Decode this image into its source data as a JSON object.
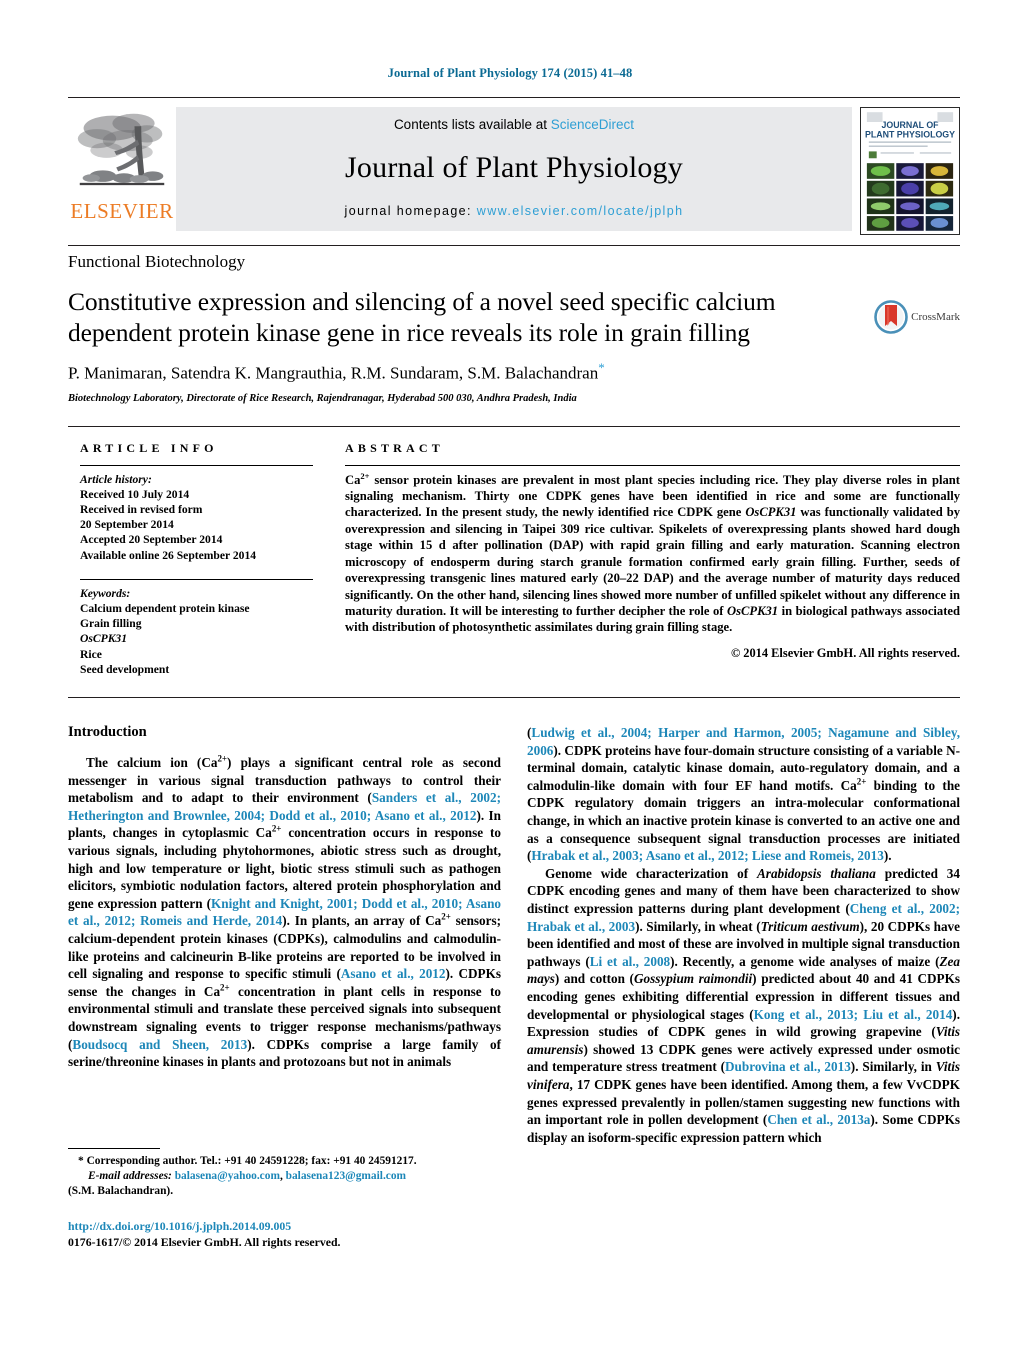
{
  "running_head": "Journal of Plant Physiology 174 (2015) 41–48",
  "masthead": {
    "contents_prefix": "Contents lists available at ",
    "sciencedirect": "ScienceDirect",
    "journal_title": "Journal of Plant Physiology",
    "homepage_prefix": "journal homepage: ",
    "homepage_url": "www.elsevier.com/locate/jplph",
    "publisher_wordmark": "ELSEVIER",
    "cover_title_line1": "JOURNAL OF",
    "cover_title_line2": "PLANT PHYSIOLOGY"
  },
  "section_label": "Functional Biotechnology",
  "title": "Constitutive expression and silencing of a novel seed specific calcium dependent protein kinase gene in rice reveals its role in grain filling",
  "authors": "P. Manimaran, Satendra K. Mangrauthia, R.M. Sundaram, S.M. Balachandran",
  "author_corresponding_marker": "*",
  "affiliation": "Biotechnology Laboratory, Directorate of Rice Research, Rajendranagar, Hyderabad 500 030, Andhra Pradesh, India",
  "crossmark_label": "CrossMark",
  "article_info": {
    "header": "ARTICLE INFO",
    "history_label": "Article history:",
    "history": [
      "Received 10 July 2014",
      "Received in revised form",
      "20 September 2014",
      "Accepted 20 September 2014",
      "Available online 26 September 2014"
    ],
    "keywords_label": "Keywords:",
    "keywords": [
      "Calcium dependent protein kinase",
      "Grain filling",
      "OsCPK31",
      "Rice",
      "Seed development"
    ],
    "keyword_italic_index": 2
  },
  "abstract": {
    "header": "ABSTRACT",
    "paragraph_parts": [
      {
        "t": "Ca",
        "s": "plain"
      },
      {
        "t": "2+",
        "s": "sup"
      },
      {
        "t": " sensor protein kinases are prevalent in most plant species including rice. They play diverse roles in plant signaling mechanism. Thirty one CDPK genes have been identified in rice and some are functionally characterized. In the present study, the newly identified rice CDPK gene ",
        "s": "plain"
      },
      {
        "t": "OsCPK31",
        "s": "italic"
      },
      {
        "t": " was functionally validated by overexpression and silencing in Taipei 309 rice cultivar. Spikelets of overexpressing plants showed hard dough stage within 15 d after pollination (DAP) with rapid grain filling and early maturation. Scanning electron microscopy of endosperm during starch granule formation confirmed early grain filling. Further, seeds of overexpressing transgenic lines matured early (20–22 DAP) and the average number of maturity days reduced significantly. On the other hand, silencing lines showed more number of unfilled spikelet without any difference in maturity duration. It will be interesting to further decipher the role of ",
        "s": "plain"
      },
      {
        "t": "OsCPK31",
        "s": "italic"
      },
      {
        "t": " in biological pathways associated with distribution of photosynthetic assimilates during grain filling stage.",
        "s": "plain"
      }
    ],
    "copyright": "© 2014 Elsevier GmbH. All rights reserved."
  },
  "introduction": {
    "heading": "Introduction",
    "left_column_parts": [
      {
        "t": "The calcium ion (Ca",
        "s": "plain"
      },
      {
        "t": "2+",
        "s": "sup"
      },
      {
        "t": ") plays a significant central role as second messenger in various signal transduction pathways to control their metabolism and to adapt to their environment (",
        "s": "plain"
      },
      {
        "t": "Sanders et al., 2002; Hetherington and Brownlee, 2004; Dodd et al., 2010; Asano et al., 2012",
        "s": "cite"
      },
      {
        "t": "). In plants, changes in cytoplasmic Ca",
        "s": "plain"
      },
      {
        "t": "2+",
        "s": "sup"
      },
      {
        "t": " concentration occurs in response to various signals, including phytohormones, abiotic stress such as drought, high and low temperature or light, biotic stress stimuli such as pathogen elicitors, symbiotic nodulation factors, altered protein phosphorylation and gene expression pattern (",
        "s": "plain"
      },
      {
        "t": "Knight and Knight, 2001; Dodd et al., 2010; Asano et al., 2012; Romeis and Herde, 2014",
        "s": "cite"
      },
      {
        "t": "). In plants, an array of Ca",
        "s": "plain"
      },
      {
        "t": "2+",
        "s": "sup"
      },
      {
        "t": " sensors; calcium-dependent protein kinases (CDPKs), calmodulins and calmodulin-like proteins and calcineurin B-like proteins are reported to be involved in cell signaling and response to specific stimuli (",
        "s": "plain"
      },
      {
        "t": "Asano et al., 2012",
        "s": "cite"
      },
      {
        "t": "). CDPKs sense the changes in Ca",
        "s": "plain"
      },
      {
        "t": "2+",
        "s": "sup"
      },
      {
        "t": " concentration in plant cells in response to environmental stimuli and translate these perceived signals into subsequent downstream signaling events to trigger response mechanisms/pathways (",
        "s": "plain"
      },
      {
        "t": "Boudsocq and Sheen, 2013",
        "s": "cite"
      },
      {
        "t": "). CDPKs comprise a large family of serine/threonine kinases in plants and protozoans but not in animals",
        "s": "plain"
      }
    ],
    "right_column_para1_parts": [
      {
        "t": "(",
        "s": "plain"
      },
      {
        "t": "Ludwig et al., 2004; Harper and Harmon, 2005; Nagamune and Sibley, 2006",
        "s": "cite"
      },
      {
        "t": "). CDPK proteins have four-domain structure consisting of a variable N-terminal domain, catalytic kinase domain, auto-regulatory domain, and a calmodulin-like domain with four EF hand motifs. Ca",
        "s": "plain"
      },
      {
        "t": "2+",
        "s": "sup"
      },
      {
        "t": " binding to the CDPK regulatory domain triggers an intra-molecular conformational change, in which an inactive protein kinase is converted to an active one and as a consequence subsequent signal transduction processes are initiated (",
        "s": "plain"
      },
      {
        "t": "Hrabak et al., 2003; Asano et al., 2012; Liese and Romeis, 2013",
        "s": "cite"
      },
      {
        "t": ").",
        "s": "plain"
      }
    ],
    "right_column_para2_parts": [
      {
        "t": "Genome wide characterization of ",
        "s": "plain"
      },
      {
        "t": "Arabidopsis thaliana",
        "s": "italic"
      },
      {
        "t": " predicted 34 CDPK encoding genes and many of them have been characterized to show distinct expression patterns during plant development (",
        "s": "plain"
      },
      {
        "t": "Cheng et al., 2002; Hrabak et al., 2003",
        "s": "cite"
      },
      {
        "t": "). Similarly, in wheat (",
        "s": "plain"
      },
      {
        "t": "Triticum aestivum",
        "s": "italic"
      },
      {
        "t": "), 20 CDPKs have been identified and most of these are involved in multiple signal transduction pathways (",
        "s": "plain"
      },
      {
        "t": "Li et al., 2008",
        "s": "cite"
      },
      {
        "t": "). Recently, a genome wide analyses of maize (",
        "s": "plain"
      },
      {
        "t": "Zea mays",
        "s": "italic"
      },
      {
        "t": ") and cotton (",
        "s": "plain"
      },
      {
        "t": "Gossypium raimondii",
        "s": "italic"
      },
      {
        "t": ") predicted about 40 and 41 CDPKs encoding genes exhibiting differential expression in different tissues and developmental or physiological stages (",
        "s": "plain"
      },
      {
        "t": "Kong et al., 2013; Liu et al., 2014",
        "s": "cite"
      },
      {
        "t": "). Expression studies of CDPK genes in wild growing grapevine (",
        "s": "plain"
      },
      {
        "t": "Vitis amurensis",
        "s": "italic"
      },
      {
        "t": ") showed 13 CDPK genes were actively expressed under osmotic and temperature stress treatment (",
        "s": "plain"
      },
      {
        "t": "Dubrovina et al., 2013",
        "s": "cite"
      },
      {
        "t": "). Similarly, in ",
        "s": "plain"
      },
      {
        "t": "Vitis vinifera",
        "s": "italic"
      },
      {
        "t": ", 17 CDPK genes have been identified. Among them, a few VvCDPK genes expressed prevalently in pollen/stamen suggesting new functions with an important role in pollen development (",
        "s": "plain"
      },
      {
        "t": "Chen et al., 2013a",
        "s": "cite"
      },
      {
        "t": "). Some CDPKs display an isoform-specific expression pattern which",
        "s": "plain"
      }
    ]
  },
  "footnote": {
    "marker": "*",
    "corresponding": "Corresponding author. Tel.: +91 40 24591228; fax: +91 40 24591217.",
    "email_label": "E-mail addresses:",
    "email1": "balasena@yahoo.com",
    "email_sep": ", ",
    "email2": "balasena123@gmail.com",
    "email_owner": "(S.M. Balachandran)."
  },
  "doi_block": {
    "doi": "http://dx.doi.org/10.1016/j.jplph.2014.09.005",
    "issn_line": "0176-1617/© 2014 Elsevier GmbH. All rights reserved."
  },
  "colors": {
    "link": "#1d87b8",
    "runhead": "#0b6a93",
    "sciencedirect": "#2e9fd4",
    "elsevier_orange": "#ec7c25",
    "masthead_bg": "#e8e9eb"
  }
}
